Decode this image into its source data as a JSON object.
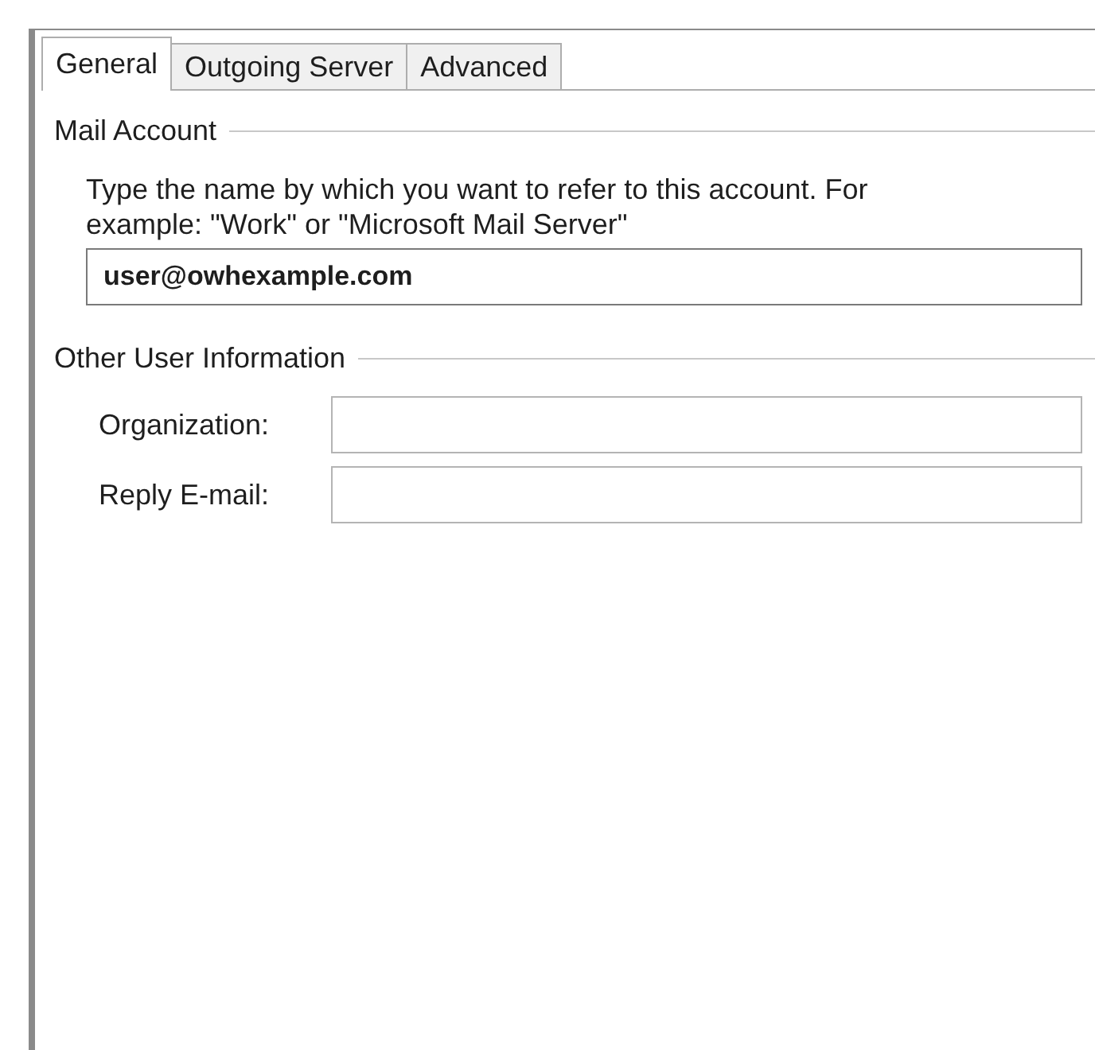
{
  "tabs": [
    {
      "label": "General",
      "selected": true
    },
    {
      "label": "Outgoing Server",
      "selected": false
    },
    {
      "label": "Advanced",
      "selected": false
    }
  ],
  "mail_account": {
    "heading": "Mail Account",
    "description": "Type the name by which you want to refer to this account. For example: \"Work\" or \"Microsoft Mail Server\"",
    "value": "user@owhexample.com"
  },
  "other_user_information": {
    "heading": "Other User Information",
    "fields": [
      {
        "label": "Organization:"
      },
      {
        "label": "Reply E-mail:"
      }
    ]
  }
}
